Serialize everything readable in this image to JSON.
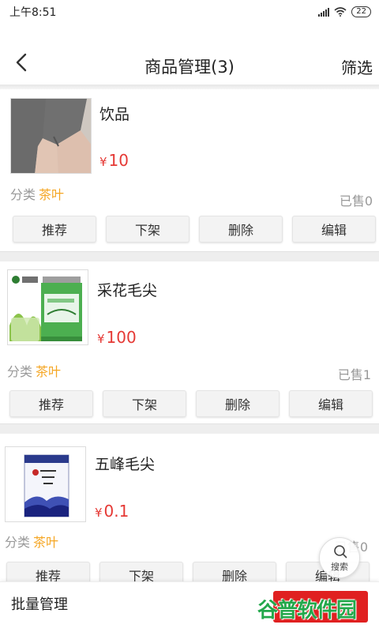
{
  "status_bar": {
    "time": "上午8:51",
    "battery": "22",
    "icons": [
      "signal-icon",
      "wifi-icon",
      "battery-icon"
    ]
  },
  "nav": {
    "back_icon": "back-chevron-icon",
    "title": "商品管理(3)",
    "filter_label": "筛选"
  },
  "products": [
    {
      "name": "饮品",
      "currency": "¥",
      "price": "10",
      "category_label": "分类",
      "category_value": "茶叶",
      "sold": "已售0",
      "buttons": [
        "推荐",
        "下架",
        "删除",
        "编辑"
      ],
      "image": "photo-sleeve"
    },
    {
      "name": "采花毛尖",
      "currency": "¥",
      "price": "100",
      "category_label": "分类",
      "category_value": "茶叶",
      "sold": "已售1",
      "buttons": [
        "推荐",
        "下架",
        "删除",
        "编辑"
      ],
      "image": "green-tea-can"
    },
    {
      "name": "五峰毛尖",
      "currency": "¥",
      "price": "0.1",
      "category_label": "分类",
      "category_value": "茶叶",
      "sold": "已售0",
      "buttons": [
        "推荐",
        "下架",
        "删除",
        "编辑"
      ],
      "image": "blue-tea-box"
    }
  ],
  "search_fab": {
    "label": "搜索",
    "icon": "search-icon"
  },
  "bottom_bar": {
    "batch_label": "批量管理"
  },
  "watermark": "谷普软件园",
  "colors": {
    "price": "#e53935",
    "category": "#f5a623",
    "primary_button": "#e02020",
    "watermark": "#23a84b"
  }
}
